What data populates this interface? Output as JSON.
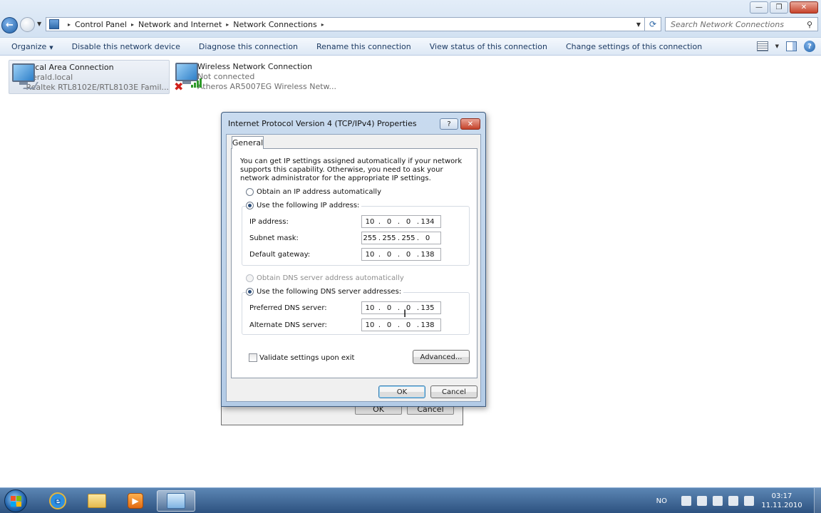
{
  "window": {
    "minimize_glyph": "—",
    "maximize_glyph": "❐",
    "close_glyph": "✕"
  },
  "nav": {
    "back_glyph": "←",
    "dropdown_glyph": "▼"
  },
  "address": {
    "crumbs": [
      "Control Panel",
      "Network and Internet",
      "Network Connections"
    ],
    "sep": "▸",
    "dropdown_glyph": "▼",
    "refresh_glyph": "⟳"
  },
  "search": {
    "placeholder": "Search Network Connections",
    "icon_glyph": "⚲"
  },
  "commandbar": {
    "organize": "Organize",
    "caret": "▼",
    "items": [
      "Disable this network device",
      "Diagnose this connection",
      "Rename this connection",
      "View status of this connection",
      "Change settings of this connection"
    ],
    "help_glyph": "?"
  },
  "connections": [
    {
      "name": "Local Area Connection",
      "status": "Gerald.local",
      "device": "Realtek RTL8102E/RTL8103E Famil..."
    },
    {
      "name": "Wireless Network Connection",
      "status": "Not connected",
      "device": "Atheros AR5007EG Wireless Netw..."
    }
  ],
  "wireless_x_glyph": "✖",
  "bg_dialog": {
    "ok": "OK",
    "cancel": "Cancel"
  },
  "dialog": {
    "title": "Internet Protocol Version 4 (TCP/IPv4) Properties",
    "help_glyph": "?",
    "close_glyph": "✕",
    "tab": "General",
    "intro": "You can get IP settings assigned automatically if your network supports this capability. Otherwise, you need to ask your network administrator for the appropriate IP settings.",
    "ip_auto": "Obtain an IP address automatically",
    "ip_manual": "Use the following IP address:",
    "ip_fields": {
      "ip_label": "IP address:",
      "ip": [
        "10",
        "0",
        "0",
        "134"
      ],
      "mask_label": "Subnet mask:",
      "mask": [
        "255",
        "255",
        "255",
        "0"
      ],
      "gateway_label": "Default gateway:",
      "gateway": [
        "10",
        "0",
        "0",
        "138"
      ]
    },
    "dns_auto": "Obtain DNS server address automatically",
    "dns_manual": "Use the following DNS server addresses:",
    "dns_fields": {
      "preferred_label": "Preferred DNS server:",
      "preferred": [
        "10",
        "0",
        "0",
        "135"
      ],
      "alternate_label": "Alternate DNS server:",
      "alternate": [
        "10",
        "0",
        "0",
        "138"
      ]
    },
    "validate": "Validate settings upon exit",
    "advanced": "Advanced...",
    "ok": "OK",
    "cancel": "Cancel"
  },
  "taskbar": {
    "ie_glyph": "e",
    "media_glyph": "▶",
    "language": "NO",
    "time": "03:17",
    "date": "11.11.2010"
  }
}
